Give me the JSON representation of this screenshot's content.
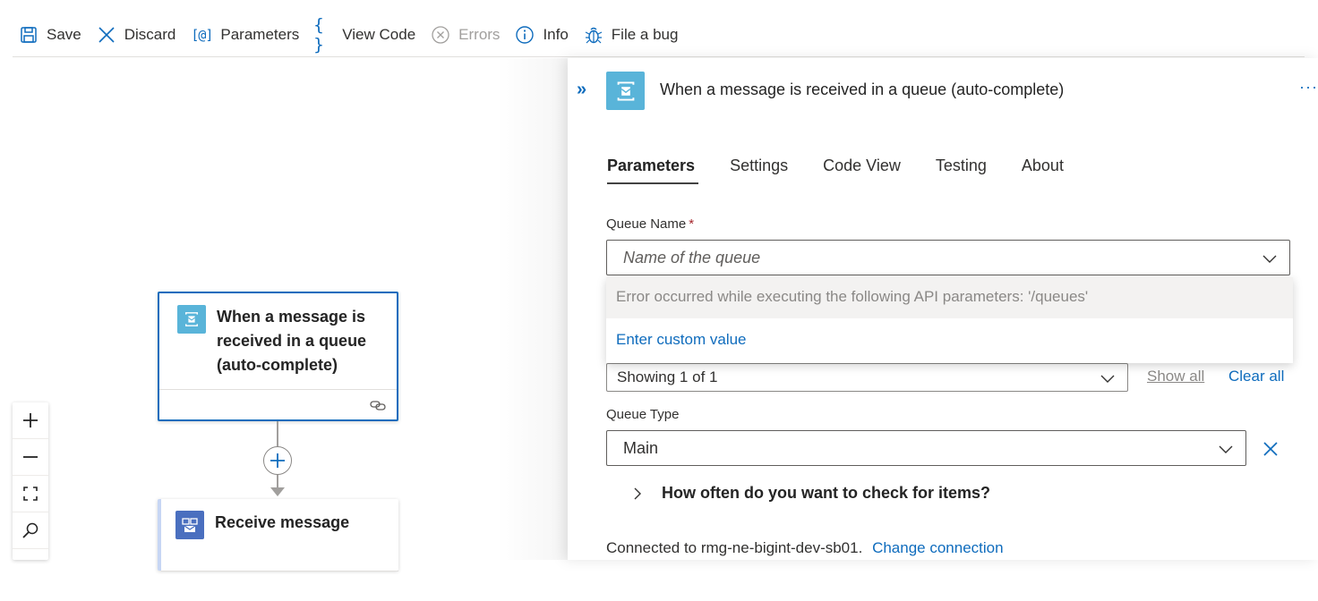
{
  "toolbar": {
    "save": "Save",
    "discard": "Discard",
    "parameters_icon": "[@]",
    "parameters": "Parameters",
    "view_code_icon": "{ }",
    "view_code": "View Code",
    "errors": "Errors",
    "info": "Info",
    "file_bug": "File a bug"
  },
  "canvas": {
    "trigger_card": {
      "title": "When a message is received in a queue (auto-complete)",
      "icon": "service-bus-icon",
      "color": "#59b4d9"
    },
    "action_card": {
      "title": "Receive message",
      "icon": "service-bus-receive-icon",
      "color": "#4a6fbf"
    },
    "zoom": [
      "zoom-in-icon",
      "zoom-out-icon",
      "fit-view-icon",
      "search-icon"
    ]
  },
  "panel": {
    "collapse_icon": "»",
    "title": "When a message is received in a queue (auto-complete)",
    "more": "···",
    "tabs": [
      "Parameters",
      "Settings",
      "Code View",
      "Testing",
      "About"
    ],
    "active_tab": "Parameters",
    "queue_name": {
      "label": "Queue Name",
      "required_mark": "*",
      "placeholder": "Name of the queue"
    },
    "dropdown": {
      "error": "Error occurred while executing the following API parameters: '/queues'",
      "custom": "Enter custom value"
    },
    "filter": {
      "value": "Showing 1 of 1",
      "show_all": "Show all",
      "clear_all": "Clear all"
    },
    "queue_type": {
      "label": "Queue Type",
      "value": "Main"
    },
    "expander": "How often do you want to check for items?",
    "connection": {
      "text": "Connected to rmg-ne-bigint-dev-sb01.",
      "change": "Change connection"
    }
  },
  "colors": {
    "accent": "#0f6cbd",
    "selected_border": "#0f6cbd",
    "required": "#a4262c"
  }
}
